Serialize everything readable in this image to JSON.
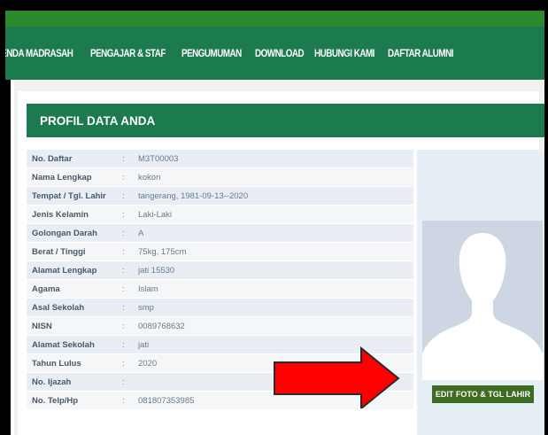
{
  "nav": {
    "items": [
      "GENDA MADRASAH",
      "PENGAJAR & STAF",
      "PENGUMUMAN",
      "DOWNLOAD",
      "HUBUNGI KAMI",
      "DAFTAR ALUMNI"
    ]
  },
  "profile": {
    "title": "PROFIL DATA ANDA",
    "separator": ":",
    "rows": [
      {
        "label": "No. Daftar",
        "value": "M3T00003"
      },
      {
        "label": "Nama Lengkap",
        "value": "kokon"
      },
      {
        "label": "Tempat / Tgl. Lahir",
        "value": "tangerang, 1981-09-13--2020"
      },
      {
        "label": "Jenis Kelamin",
        "value": "Laki-Laki"
      },
      {
        "label": "Golongan Darah",
        "value": "A"
      },
      {
        "label": "Berat / Tinggi",
        "value": "75kg, 175cm"
      },
      {
        "label": "Alamat Lengkap",
        "value": "jati 15530"
      },
      {
        "label": "Agama",
        "value": "Islam"
      },
      {
        "label": "Asal Sekolah",
        "value": "smp"
      },
      {
        "label": "NISN",
        "value": "0089768632"
      },
      {
        "label": "Alamat Sekolah",
        "value": "jati"
      },
      {
        "label": "Tahun Lulus",
        "value": "2020"
      },
      {
        "label": "No. Ijazah",
        "value": ""
      },
      {
        "label": "No. Telp/Hp",
        "value": "081807353985"
      }
    ]
  },
  "photo": {
    "edit_button": "EDIT FOTO & TGL LAHIR",
    "placeholder_icon": "person-silhouette-icon"
  },
  "annotation": {
    "arrow_icon": "red-arrow-icon",
    "arrow_color": "#ff0000"
  },
  "colors": {
    "nav_bg": "#1b7a4e",
    "top_strip": "#2b8a2b",
    "header_bg": "#1b7a4e",
    "button_bg": "#3d6b1f"
  }
}
